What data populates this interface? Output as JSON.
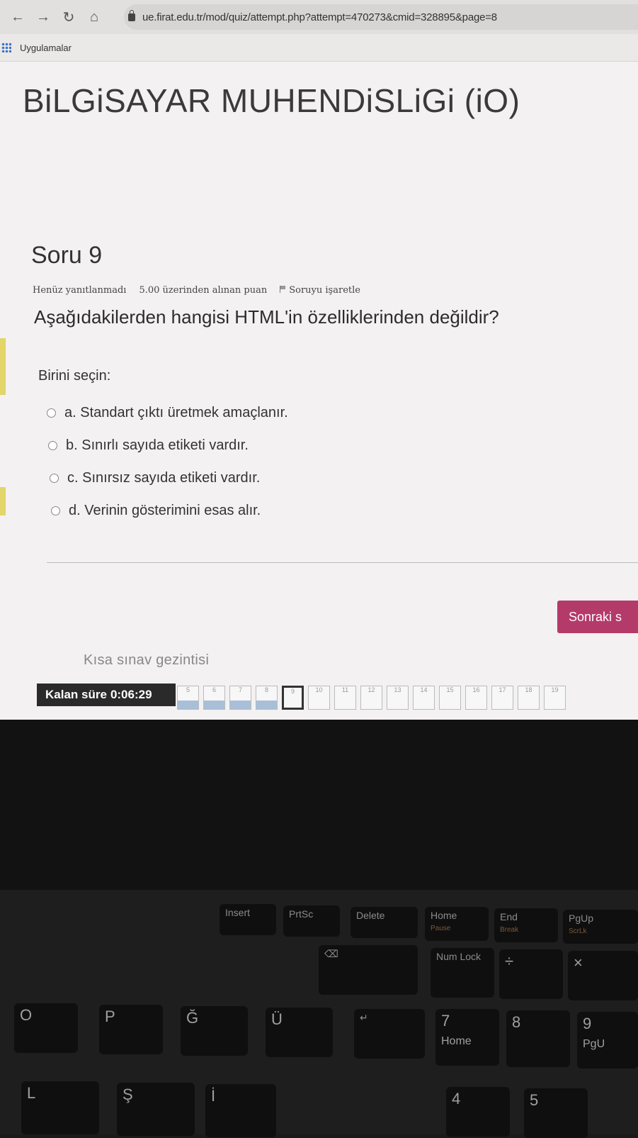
{
  "browser": {
    "url": "ue.firat.edu.tr/mod/quiz/attempt.php?attempt=470273&cmid=328895&page=8",
    "bookmarks_label": "Uygulamalar"
  },
  "site": {
    "title": "BiLGiSAYAR MUHENDiSLiGi (iO)"
  },
  "question": {
    "number_label": "Soru 9",
    "status": "Henüz yanıtlanmadı",
    "points": "5.00 üzerinden alınan puan",
    "flag_label": "Soruyu işaretle",
    "text": "Aşağıdakilerden hangisi HTML'in özelliklerinden değildir?",
    "prompt": "Birini seçin:",
    "answers": [
      "a. Standart çıktı üretmek amaçlanır.",
      "b. Sınırlı sayıda etiketi vardır.",
      "c. Sınırsız sayıda etiketi vardır.",
      "d. Verinin gösterimini esas alır."
    ]
  },
  "next_button": "Sonraki s",
  "quiz_nav": {
    "label": "Kısa sınav gezintisi",
    "timer_label": "Kalan süre",
    "timer_value": "0:06:29",
    "pages": [
      "5",
      "6",
      "7",
      "8",
      "9",
      "10",
      "11",
      "12",
      "13",
      "14",
      "15",
      "16",
      "17",
      "18",
      "19"
    ],
    "answered": [
      "5",
      "6",
      "7",
      "8"
    ],
    "current": "9"
  },
  "keyboard": {
    "row1": [
      "Insert",
      "PrtSc",
      "Delete",
      "Home",
      "End",
      "PgUp"
    ],
    "row1_sub": [
      "",
      "",
      "",
      "Pause",
      "Break",
      "ScrLk"
    ],
    "row2": [
      "Num Lock",
      "÷",
      "×"
    ],
    "row3": [
      "O",
      "P",
      "Ğ",
      "Ü",
      "7",
      "8",
      "9"
    ],
    "row4": [
      "Home",
      "PgU"
    ],
    "row5": [
      "L",
      "Ş",
      "İ",
      "4",
      "5"
    ]
  }
}
